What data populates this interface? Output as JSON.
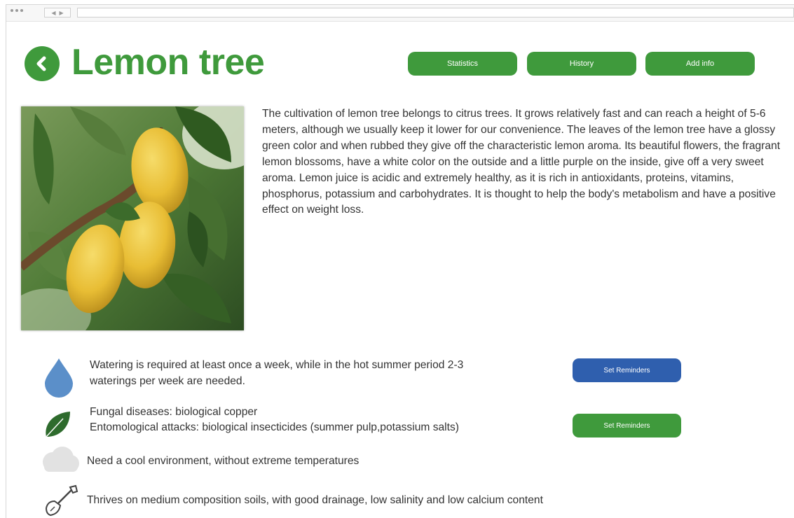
{
  "page": {
    "title": "Lemon tree",
    "description": "The cultivation of lemon tree belongs to citrus trees. It grows relatively fast and can reach a height of 5-6 meters, although we usually keep it lower for our convenience. The leaves of the lemon tree have a glossy green color and when rubbed they give off the characteristic lemon aroma. Its beautiful flowers, the fragrant lemon blossoms, have a white color on the outside and a little purple on the inside, give off a very sweet aroma. Lemon juice is acidic and extremely healthy, as it is rich in antioxidants, proteins, vitamins, phosphorus, potassium and carbohydrates. It is thought to help the body's metabolism and have a positive effect on weight loss."
  },
  "nav": {
    "statistics_label": "Statistics",
    "history_label": "History",
    "add_info_label": "Add info"
  },
  "care": {
    "watering_line1": "Watering is required at least once a week, while in the hot summer period 2-3",
    "watering_line2": "waterings per week are needed.",
    "watering_reminder_label": "Set Reminders",
    "pests_line1": "Fungal diseases: biological copper",
    "pests_line2": "Entomological attacks: biological insecticides (summer pulp,potassium salts)",
    "pests_reminder_label": "Set Reminders",
    "climate_text": "Need a cool environment, without extreme temperatures",
    "soil_text": "Thrives on medium composition soils, with good drainage, low salinity and low calcium content"
  },
  "icons": {
    "back": "chevron-left-icon",
    "watering": "water-drop-icon",
    "pests": "leaf-icon",
    "climate": "cloud-icon",
    "soil": "shovel-icon"
  },
  "colors": {
    "primary_green": "#3f9a3c",
    "reminder_blue": "#2f5fae",
    "water_blue": "#5b8fc9",
    "leaf_green": "#2e6b2d",
    "cloud_gray": "#e2e2e2"
  }
}
